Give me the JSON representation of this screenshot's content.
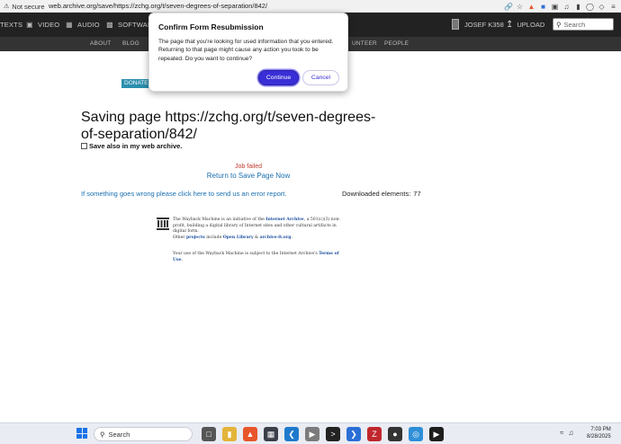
{
  "browser": {
    "security_label": "Not secure",
    "url": "web.archive.org/save/https://zchg.org/t/seven-degrees-of-separation/842/"
  },
  "topnav": {
    "items": [
      {
        "label": "TEXTS",
        "icon": "book-icon"
      },
      {
        "label": "VIDEO",
        "icon": "film-icon"
      },
      {
        "label": "AUDIO",
        "icon": "speaker-icon"
      },
      {
        "label": "SOFTWARE",
        "icon": "floppy-icon"
      }
    ],
    "username": "JOSEF K358",
    "upload_label": "UPLOAD",
    "search_placeholder": "Search"
  },
  "subnav": {
    "items": [
      "ABOUT",
      "BLOG",
      "UNTEER",
      "PEOPLE"
    ]
  },
  "donate_label": "DONATE",
  "page": {
    "heading": "Saving page https://zchg.org/t/seven-degrees-of-separation/842/",
    "save_also_label": "Save also in my web archive.",
    "job_status": "Job failed",
    "return_link": "Return to Save Page Now",
    "error_link": "If something goes wrong please click here to send us an error report.",
    "downloaded_label": "Downloaded elements:",
    "downloaded_count": "77"
  },
  "footer": {
    "line1_pre": "The Wayback Machine is an initiative of the ",
    "line1_link": "Internet Archive",
    "line1_post": ", a 501(c)(3) non-profit, building a digital library of Internet sites and other cultural artifacts in digital form.",
    "line2_pre": "Other ",
    "line2_link1": "projects",
    "line2_mid": " include ",
    "line2_link2": "Open Library",
    "line2_amp": " & ",
    "line2_link3": "archive-it.org",
    "line2_post": ".",
    "terms_pre": "Your use of the Wayback Machine is subject to the Internet Archive's ",
    "terms_link": "Terms of Use",
    "terms_post": "."
  },
  "dialog": {
    "title": "Confirm Form Resubmission",
    "message": "The page that you're looking for used information that you entered. Returning to that page might cause any action you took to be repeated. Do you want to continue?",
    "continue_label": "Continue",
    "cancel_label": "Cancel"
  },
  "taskbar": {
    "search_label": "Search",
    "time": "7:03 PM",
    "date": "8/28/2025"
  }
}
